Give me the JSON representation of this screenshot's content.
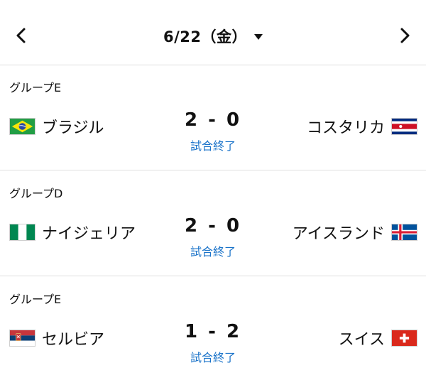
{
  "header": {
    "date": "6/22（金）",
    "prev_icon": "chevron-left-icon",
    "next_icon": "chevron-right-icon",
    "dropdown_icon": "caret-down-icon"
  },
  "matches": [
    {
      "group": "グループE",
      "home": {
        "name": "ブラジル",
        "flag": "brazil-flag-icon"
      },
      "score": "2 - 0",
      "status": "試合終了",
      "away": {
        "name": "コスタリカ",
        "flag": "costa-rica-flag-icon"
      }
    },
    {
      "group": "グループD",
      "home": {
        "name": "ナイジェリア",
        "flag": "nigeria-flag-icon"
      },
      "score": "2 - 0",
      "status": "試合終了",
      "away": {
        "name": "アイスランド",
        "flag": "iceland-flag-icon"
      }
    },
    {
      "group": "グループE",
      "home": {
        "name": "セルビア",
        "flag": "serbia-flag-icon"
      },
      "score": "1 - 2",
      "status": "試合終了",
      "away": {
        "name": "スイス",
        "flag": "switzerland-flag-icon"
      }
    }
  ],
  "colors": {
    "status": "#1a73c9",
    "divider": "#dedede"
  }
}
